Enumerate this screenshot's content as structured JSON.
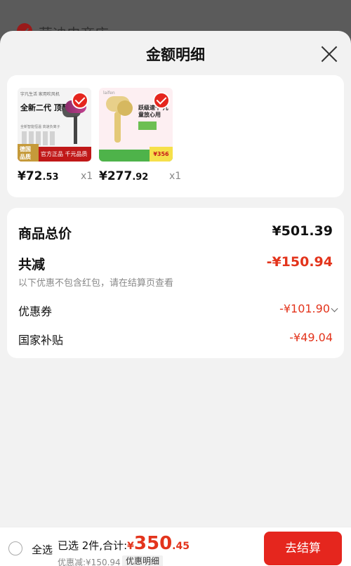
{
  "background_shop": {
    "name": "荣迪电商店 ›"
  },
  "sheet": {
    "title": "金额明细"
  },
  "products": [
    {
      "price_main": "¥72",
      "price_decimal": ".53",
      "qty": "x1",
      "thumb": {
        "header": "宇凡生活 家用吹风机",
        "headline": "全新二代 顶配1:1",
        "sub": "全新智能恒温 高速负离子",
        "badge_left": "德国 品质",
        "badge_text": "官方正品 千元品质"
      }
    },
    {
      "price_main": "¥277",
      "price_decimal": ".92",
      "qty": "x1",
      "thumb": {
        "brand": "laifen",
        "text": "跃级速干 儿童放心用",
        "promo": "¥356"
      }
    }
  ],
  "summary": {
    "total_label": "商品总价",
    "total_value": "¥501.39",
    "reduce_label": "共减",
    "reduce_value": "-¥150.94",
    "note": "以下优惠不包含红包，请在结算页查看",
    "coupon_label": "优惠券",
    "coupon_value": "-¥101.90",
    "subsidy_label": "国家补贴",
    "subsidy_value": "-¥49.04"
  },
  "bottom": {
    "select_all": "全选",
    "selected_text": "已选 2件,合计:",
    "currency": "¥",
    "amount_int": "350",
    "amount_dec": ".45",
    "discount_text": "优惠减:¥150.94",
    "detail_tag": "优惠明细",
    "checkout": "去结算"
  },
  "colors": {
    "accent": "#e5261e",
    "price_red": "#e3341c"
  }
}
